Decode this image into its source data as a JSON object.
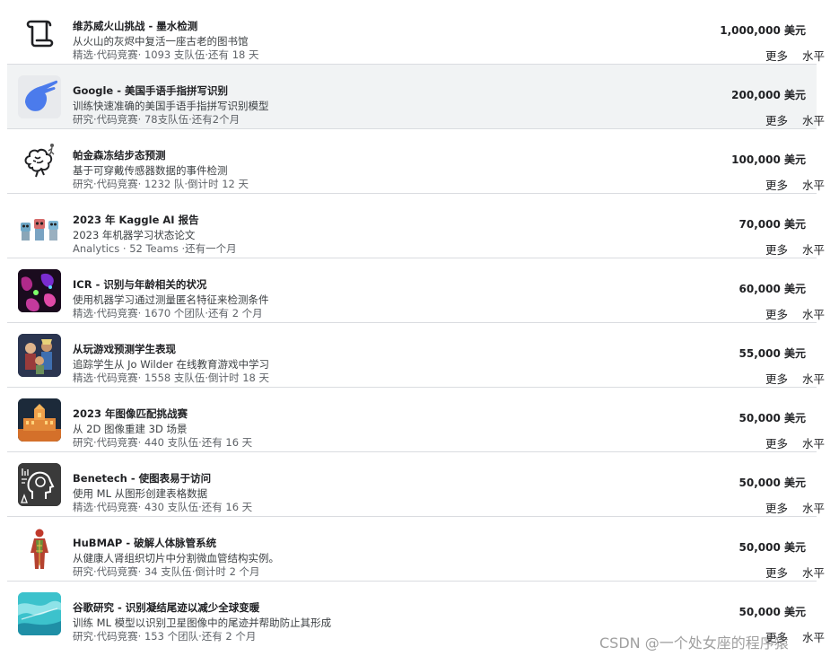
{
  "competitions": [
    {
      "title": "维苏威火山挑战 - 墨水检测",
      "description": "从火山的灰烬中复活一座古老的图书馆",
      "meta": "精选·代码竞赛· 1093 支队伍·还有 18 天",
      "prize": "1,000,000 美元",
      "more_label": "更多",
      "level_label": "水平",
      "icon": "scroll-icon"
    },
    {
      "title": "Google - 美国手语手指拼写识别",
      "description": "训练快速准确的美国手语手指拼写识别模型",
      "meta": "研究·代码竞赛· 78支队伍·还有2个月",
      "prize": "200,000 美元",
      "more_label": "更多",
      "level_label": "水平",
      "icon": "hand-icon"
    },
    {
      "title": "帕金森冻结步态预测",
      "description": "基于可穿戴传感器数据的事件检测",
      "meta": "研究·代码竞赛· 1232 队·倒计时 12 天",
      "prize": "100,000 美元",
      "more_label": "更多",
      "level_label": "水平",
      "icon": "brain-icon"
    },
    {
      "title": "2023 年 Kaggle AI 报告",
      "description": "2023 年机器学习状态论文",
      "meta": "Analytics · 52 Teams ·还有一个月",
      "prize": "70,000 美元",
      "more_label": "更多",
      "level_label": "水平",
      "icon": "robots-icon"
    },
    {
      "title": "ICR - 识别与年龄相关的状况",
      "description": "使用机器学习通过测量匿名特征来检测条件",
      "meta": "精选·代码竞赛· 1670 个团队·还有 2 个月",
      "prize": "60,000 美元",
      "more_label": "更多",
      "level_label": "水平",
      "icon": "cells-icon"
    },
    {
      "title": "从玩游戏预测学生表现",
      "description": "追踪学生从 Jo Wilder 在线教育游戏中学习",
      "meta": "精选·代码竞赛· 1558 支队伍·倒计时 18 天",
      "prize": "55,000 美元",
      "more_label": "更多",
      "level_label": "水平",
      "icon": "game-icon"
    },
    {
      "title": "2023 年图像匹配挑战赛",
      "description": "从 2D 图像重建 3D 场景",
      "meta": "研究·代码竞赛· 440 支队伍·还有 16 天",
      "prize": "50,000 美元",
      "more_label": "更多",
      "level_label": "水平",
      "icon": "building-icon"
    },
    {
      "title": "Benetech - 使图表易于访问",
      "description": "使用 ML 从图形创建表格数据",
      "meta": "精选·代码竞赛· 430 支队伍·还有 16 天",
      "prize": "50,000 美元",
      "more_label": "更多",
      "level_label": "水平",
      "icon": "head-icon"
    },
    {
      "title": "HuBMAP - 破解人体脉管系统",
      "description": "从健康人肾组织切片中分割微血管结构实例。",
      "meta": "研究·代码竞赛· 34 支队伍·倒计时 2 个月",
      "prize": "50,000 美元",
      "more_label": "更多",
      "level_label": "水平",
      "icon": "body-icon"
    },
    {
      "title": "谷歌研究 - 识别凝结尾迹以减少全球变暖",
      "description": "训练 ML 模型以识别卫星图像中的尾迹并帮助防止其形成",
      "meta": "研究·代码竞赛· 153 个团队·还有 2 个月",
      "prize": "50,000 美元",
      "more_label": "更多",
      "level_label": "水平",
      "icon": "satellite-icon"
    }
  ],
  "watermark": "CSDN @一个处女座的程序猿"
}
